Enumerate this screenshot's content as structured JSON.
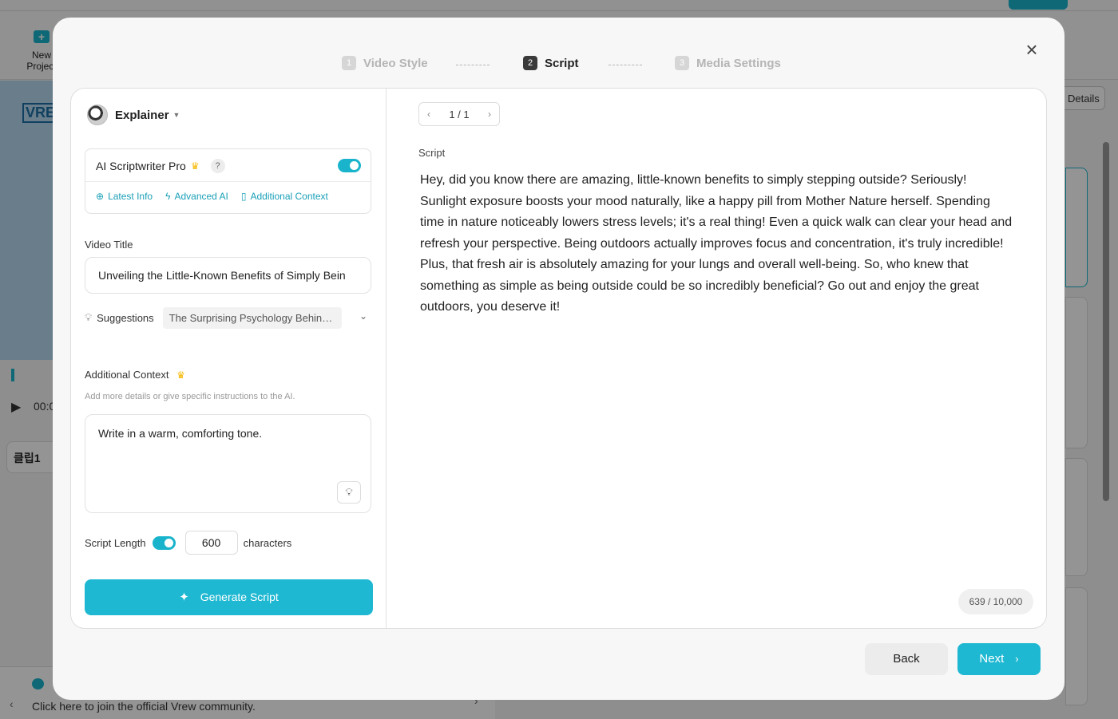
{
  "background": {
    "new_project_label": "New Project",
    "preview_logo": "VREW",
    "time_label": "00:0",
    "clip_label": "클립1",
    "community_text": "Click here to join the official Vrew community.",
    "details_label": "Details"
  },
  "modal": {
    "steps": [
      {
        "num": "1",
        "label": "Video Style"
      },
      {
        "num": "2",
        "label": "Script"
      },
      {
        "num": "3",
        "label": "Media Settings"
      }
    ],
    "active_step": 2
  },
  "style": {
    "name": "Explainer"
  },
  "ai_scriptwriter": {
    "label": "AI Scriptwriter Pro",
    "enabled": true,
    "links": [
      "Latest Info",
      "Advanced AI",
      "Additional Context"
    ]
  },
  "video_title": {
    "label": "Video Title",
    "value": "Unveiling the Little-Known Benefits of Simply Bein"
  },
  "suggestions": {
    "label": "Suggestions",
    "value": "The Surprising Psychology Behind..."
  },
  "additional_context": {
    "label": "Additional Context",
    "hint": "Add more details or give specific instructions to the AI.",
    "value": "Write in a warm, comforting tone."
  },
  "script_length": {
    "label": "Script Length",
    "enabled": true,
    "value": "600",
    "unit": "characters"
  },
  "generate_button": "Generate Script",
  "script": {
    "pager": "1 / 1",
    "label": "Script",
    "text": "Hey, did you know there are amazing, little-known benefits to simply stepping outside? Seriously! Sunlight exposure boosts your mood naturally, like a happy pill from Mother Nature herself. Spending time in nature noticeably lowers stress levels; it's a real thing! Even a quick walk can clear your head and refresh your perspective. Being outdoors actually improves focus and concentration, it's truly incredible! Plus, that fresh air is absolutely amazing for your lungs and overall well-being. So, who knew that something as simple as being outside could be so incredibly beneficial? Go out and enjoy the great outdoors, you deserve it!",
    "char_count": "639 / 10,000"
  },
  "footer": {
    "back": "Back",
    "next": "Next"
  },
  "colors": {
    "accent": "#1fb8d2",
    "link": "#1aa0b8",
    "crown": "#f5b800"
  }
}
